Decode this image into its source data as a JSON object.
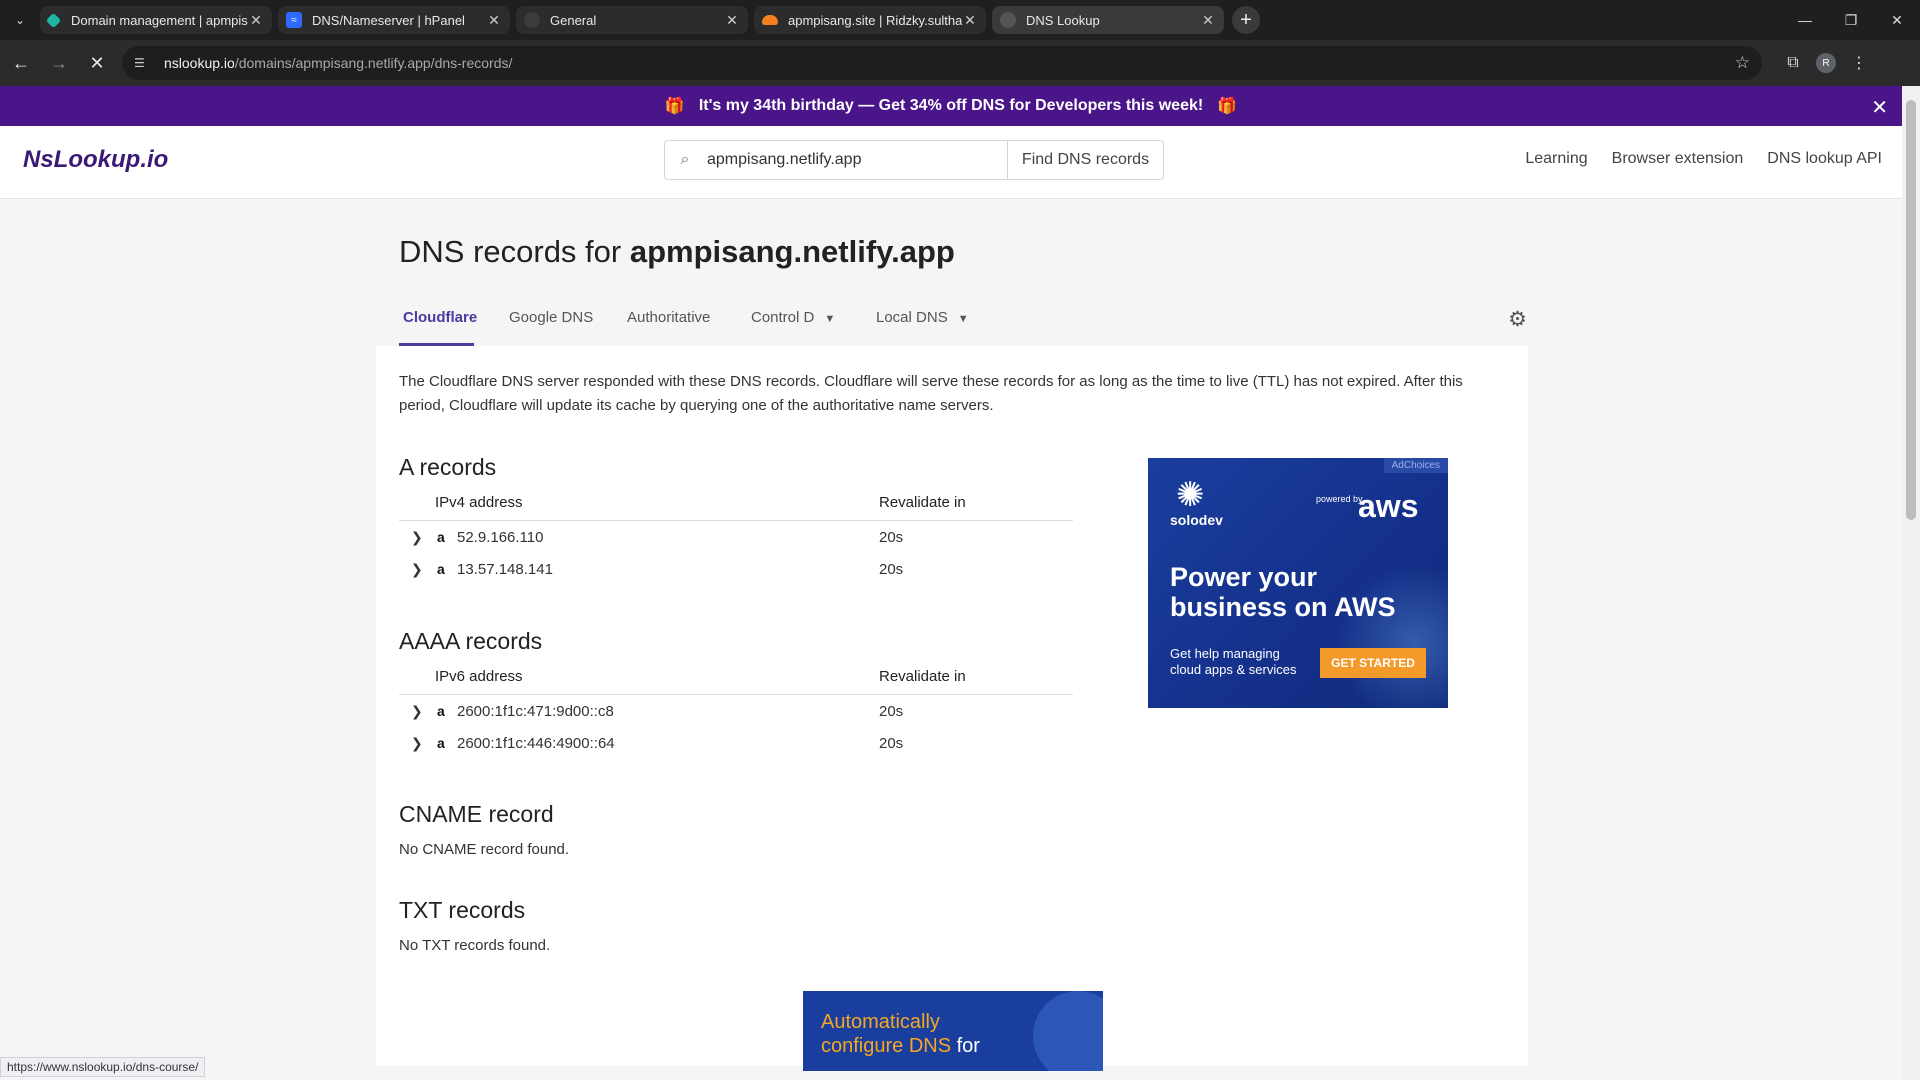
{
  "browser": {
    "tabs": [
      {
        "title": "Domain management | apmpis",
        "favicon_color": "#1fb5a6",
        "active": false
      },
      {
        "title": "DNS/Nameserver | hPanel",
        "favicon_color": "#2f6bff",
        "active": false
      },
      {
        "title": "General",
        "favicon_color": "#444444",
        "active": false
      },
      {
        "title": "apmpisang.site | Ridzky.sulthan",
        "favicon_color": "#f38020",
        "active": false
      },
      {
        "title": "DNS Lookup",
        "favicon_color": "#555555",
        "active": true
      }
    ],
    "url_host": "nslookup.io",
    "url_path": "/domains/apmpisang.netlify.app/dns-records/",
    "avatar_letter": "R"
  },
  "banner": {
    "text": "It's my 34th birthday — Get 34% off DNS for Developers this week!",
    "bg_color": "#4a1589"
  },
  "header": {
    "logo": "NsLookup.io",
    "search_value": "apmpisang.netlify.app",
    "search_button": "Find DNS records",
    "nav": [
      "Learning",
      "Browser extension",
      "DNS lookup API"
    ]
  },
  "page": {
    "title_prefix": "DNS records for ",
    "title_domain": "apmpisang.netlify.app",
    "tabs": [
      "Cloudflare",
      "Google DNS",
      "Authoritative",
      "Control D",
      "Local DNS"
    ],
    "active_tab": "Cloudflare",
    "accent_color": "#4b3aa0",
    "intro": "The Cloudflare DNS server responded with these DNS records. Cloudflare will serve these records for as long as the time to live (TTL) has not expired. After this period, Cloudflare will update its cache by querying one of the authoritative name servers."
  },
  "a_records": {
    "title": "A records",
    "col1": "IPv4 address",
    "col2": "Revalidate in",
    "rows": [
      {
        "value": "52.9.166.110",
        "ttl": "20s"
      },
      {
        "value": "13.57.148.141",
        "ttl": "20s"
      }
    ]
  },
  "aaaa_records": {
    "title": "AAAA records",
    "col1": "IPv6 address",
    "col2": "Revalidate in",
    "rows": [
      {
        "value": "2600:1f1c:471:9d00::c8",
        "ttl": "20s"
      },
      {
        "value": "2600:1f1c:446:4900::64",
        "ttl": "20s"
      }
    ]
  },
  "cname": {
    "title": "CNAME record",
    "note": "No CNAME record found."
  },
  "txt": {
    "title": "TXT records",
    "note": "No TXT records found."
  },
  "ad": {
    "adchoices": "AdChoices",
    "brand": "solodev",
    "powered": "powered by",
    "aws": "aws",
    "headline": "Power your business on AWS",
    "sub": "Get help managing cloud apps & services",
    "cta": "GET STARTED"
  },
  "ad2": {
    "line1": "Automatically",
    "line2_a": "configure DNS ",
    "line2_b": "for"
  },
  "status_url": "https://www.nslookup.io/dns-course/"
}
